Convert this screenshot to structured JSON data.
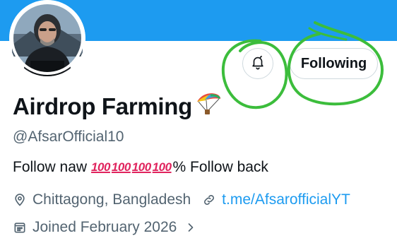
{
  "profile": {
    "display_name": "Airdrop Farming",
    "handle": "@AfsarOfficial10",
    "bio_start": "Follow naw",
    "bio_hundreds": [
      "100",
      "100",
      "100",
      "100"
    ],
    "bio_end": "% Follow back",
    "location": "Chittagong, Bangladesh",
    "website": "t.me/AfsarofficialYT",
    "joined": "Joined February 2026"
  },
  "actions": {
    "following_label": "Following"
  },
  "icons": {
    "notifications": "bell-icon",
    "location": "location-pin-icon",
    "website": "link-icon",
    "joined": "calendar-icon",
    "expand": "chevron-right-icon",
    "name_emoji": "parachute-emoji"
  },
  "colors": {
    "banner": "#1d9bf0",
    "link": "#1d9bf0",
    "secondary_text": "#536471",
    "annotation": "#3cbd3c",
    "hundred_emoji": "#e0245e"
  }
}
